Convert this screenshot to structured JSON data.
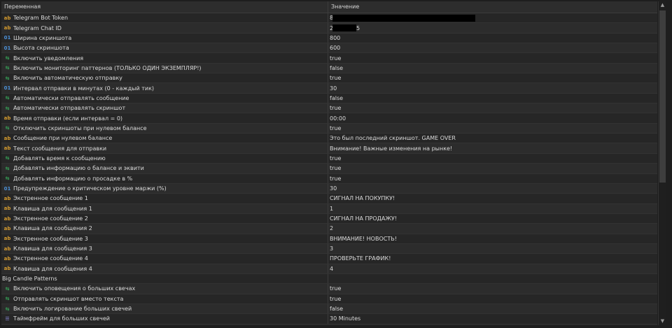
{
  "header": {
    "col_name": "Переменная",
    "col_value": "Значение"
  },
  "rows": [
    {
      "icon": "ab",
      "name": "Telegram Bot Token",
      "value": "8",
      "redact": [
        0,
        210
      ]
    },
    {
      "icon": "ab",
      "name": "Telegram Chat ID",
      "value": "2",
      "redact": [
        0,
        40
      ],
      "tail": "5"
    },
    {
      "icon": "num",
      "name": "Ширина скриншота",
      "value": "800"
    },
    {
      "icon": "num",
      "name": "Высота скриншота",
      "value": "600"
    },
    {
      "icon": "bool",
      "name": "Включить уведомления",
      "value": "true"
    },
    {
      "icon": "bool",
      "name": "Включить мониторинг паттернов (ТОЛЬКО ОДИН ЭКЗЕМПЛЯР!)",
      "value": "false"
    },
    {
      "icon": "bool",
      "name": "Включить автоматическую отправку",
      "value": "true"
    },
    {
      "icon": "num",
      "name": "Интервал отправки в минутах (0 - каждый тик)",
      "value": "30"
    },
    {
      "icon": "bool",
      "name": "Автоматически отправлять сообщение",
      "value": "false"
    },
    {
      "icon": "bool",
      "name": "Автоматически отправлять скриншот",
      "value": "true"
    },
    {
      "icon": "ab",
      "name": "Время отправки (если интервал = 0)",
      "value": "00:00"
    },
    {
      "icon": "bool",
      "name": "Отключить скриншоты при нулевом балансе",
      "value": "true"
    },
    {
      "icon": "ab",
      "name": "Сообщение при нулевом балансе",
      "value": "Это был последний скриншот. GAME OVER"
    },
    {
      "icon": "ab",
      "name": "Текст сообщения для отправки",
      "value": "Внимание! Важные изменения на рынке!"
    },
    {
      "icon": "bool",
      "name": "Добавлять время к сообщению",
      "value": "true"
    },
    {
      "icon": "bool",
      "name": "Добавлять информацию о балансе и эквити",
      "value": "true"
    },
    {
      "icon": "bool",
      "name": "Добавлять информацию о просадке в %",
      "value": "true"
    },
    {
      "icon": "num",
      "name": "Предупреждение о критическом уровне маржи (%)",
      "value": "30"
    },
    {
      "icon": "ab",
      "name": "Экстренное сообщение 1",
      "value": "СИГНАЛ НА ПОКУПКУ!"
    },
    {
      "icon": "ab",
      "name": "Клавиша для сообщения 1",
      "value": "1"
    },
    {
      "icon": "ab",
      "name": "Экстренное сообщение 2",
      "value": "СИГНАЛ НА ПРОДАЖУ!"
    },
    {
      "icon": "ab",
      "name": "Клавиша для сообщения 2",
      "value": "2"
    },
    {
      "icon": "ab",
      "name": "Экстренное сообщение 3",
      "value": "ВНИМАНИЕ! НОВОСТЬ!"
    },
    {
      "icon": "ab",
      "name": "Клавиша для сообщения 3",
      "value": "3"
    },
    {
      "icon": "ab",
      "name": "Экстренное сообщение 4",
      "value": "ПРОВЕРЬТЕ ГРАФИК!"
    },
    {
      "icon": "ab",
      "name": "Клавиша для сообщения 4",
      "value": "4"
    },
    {
      "icon": "none",
      "name": "Big Candle Patterns",
      "value": "",
      "group": true
    },
    {
      "icon": "bool",
      "name": "Включить оповещения о больших свечах",
      "value": "true"
    },
    {
      "icon": "bool",
      "name": "Отправлять скриншот вместо текста",
      "value": "true"
    },
    {
      "icon": "bool",
      "name": "Включить логирование больших свечей",
      "value": "false"
    },
    {
      "icon": "enum",
      "name": "Таймфрейм для больших свечей",
      "value": "30 Minutes"
    }
  ],
  "icons": {
    "ab": "ab",
    "num": "01",
    "bool": "⇆",
    "enum": "☰"
  },
  "colors": {
    "string_icon": "#d39a2e",
    "number_icon": "#4b8fd6",
    "bool_icon": "#37a85a"
  }
}
